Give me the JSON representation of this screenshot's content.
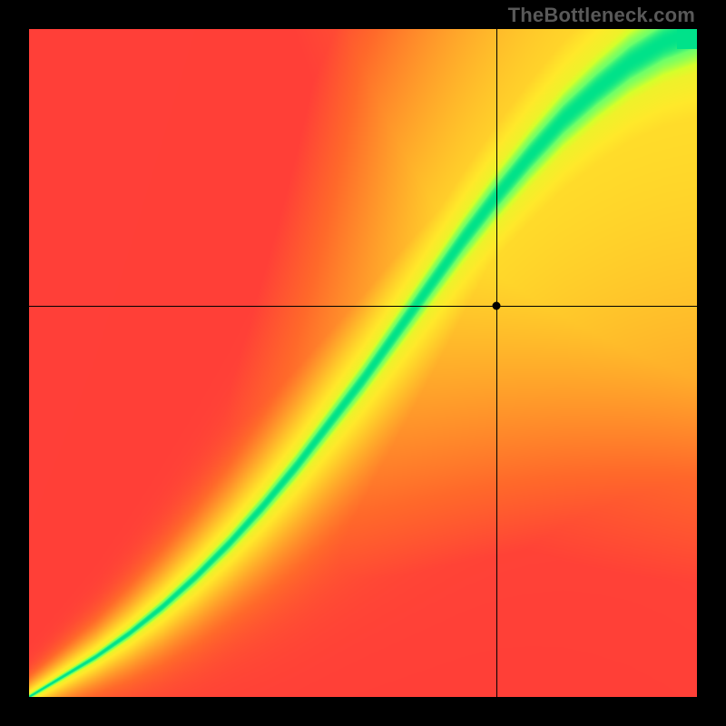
{
  "watermark": "TheBottleneck.com",
  "chart_data": {
    "type": "heatmap",
    "title": "",
    "xlabel": "",
    "ylabel": "",
    "xlim": [
      0,
      1
    ],
    "ylim": [
      0,
      1
    ],
    "grid": false,
    "legend": false,
    "crosshair": {
      "x": 0.7,
      "y": 0.585
    },
    "marker": {
      "x": 0.7,
      "y": 0.585
    },
    "colorscale": {
      "description": "red→orange→yellow→green from worst to best match",
      "stops": [
        {
          "value": 0.0,
          "color": "#ff2a3f"
        },
        {
          "value": 0.3,
          "color": "#ff6a2a"
        },
        {
          "value": 0.55,
          "color": "#ffb02a"
        },
        {
          "value": 0.75,
          "color": "#ffe92a"
        },
        {
          "value": 0.88,
          "color": "#d6ff2a"
        },
        {
          "value": 0.97,
          "color": "#6dff6a"
        },
        {
          "value": 1.0,
          "color": "#00e28a"
        }
      ]
    },
    "field": {
      "description": "Bottleneck compatibility surface. Match score = f(x,y) in [0,1]; 1 on a curved ridge from (0,0) to (1,1). Ridge bows below the diagonal for small x and sits slightly above the diagonal for large x.",
      "resolution": 160,
      "ridge_samples": [
        {
          "x": 0.0,
          "y": 0.0
        },
        {
          "x": 0.05,
          "y": 0.03
        },
        {
          "x": 0.1,
          "y": 0.06
        },
        {
          "x": 0.15,
          "y": 0.095
        },
        {
          "x": 0.2,
          "y": 0.135
        },
        {
          "x": 0.25,
          "y": 0.18
        },
        {
          "x": 0.3,
          "y": 0.23
        },
        {
          "x": 0.35,
          "y": 0.285
        },
        {
          "x": 0.4,
          "y": 0.345
        },
        {
          "x": 0.45,
          "y": 0.41
        },
        {
          "x": 0.5,
          "y": 0.475
        },
        {
          "x": 0.55,
          "y": 0.545
        },
        {
          "x": 0.6,
          "y": 0.615
        },
        {
          "x": 0.65,
          "y": 0.685
        },
        {
          "x": 0.7,
          "y": 0.75
        },
        {
          "x": 0.75,
          "y": 0.81
        },
        {
          "x": 0.8,
          "y": 0.865
        },
        {
          "x": 0.85,
          "y": 0.91
        },
        {
          "x": 0.9,
          "y": 0.95
        },
        {
          "x": 0.95,
          "y": 0.98
        },
        {
          "x": 1.0,
          "y": 1.0
        }
      ],
      "ridge_halfwidth_samples": [
        {
          "x": 0.0,
          "w": 0.01
        },
        {
          "x": 0.1,
          "w": 0.018
        },
        {
          "x": 0.2,
          "w": 0.028
        },
        {
          "x": 0.3,
          "w": 0.038
        },
        {
          "x": 0.4,
          "w": 0.05
        },
        {
          "x": 0.5,
          "w": 0.062
        },
        {
          "x": 0.6,
          "w": 0.076
        },
        {
          "x": 0.7,
          "w": 0.09
        },
        {
          "x": 0.8,
          "w": 0.105
        },
        {
          "x": 0.9,
          "w": 0.12
        },
        {
          "x": 1.0,
          "w": 0.135
        }
      ]
    }
  }
}
